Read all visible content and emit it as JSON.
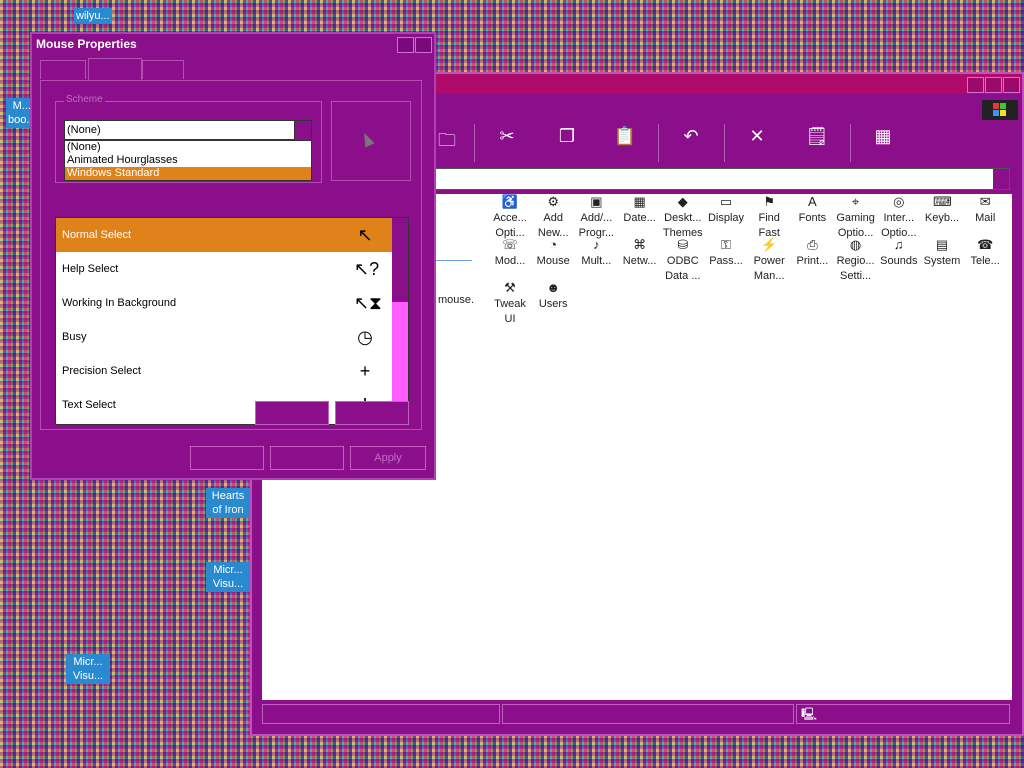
{
  "desktop": {
    "icons": [
      {
        "label": "wilyu..."
      },
      {
        "label": "M... boo..."
      },
      {
        "label": "Hearts of Iron"
      },
      {
        "label": "Micr... Visu..."
      },
      {
        "label": "Micr... Visu..."
      }
    ]
  },
  "control_panel": {
    "description_fragment": "mouse.",
    "items": [
      {
        "label": "Acce... Opti...",
        "icon": "accessibility-icon"
      },
      {
        "label": "Add New...",
        "icon": "add-hardware-icon"
      },
      {
        "label": "Add/... Progr...",
        "icon": "add-remove-programs-icon"
      },
      {
        "label": "Date...",
        "icon": "date-time-icon"
      },
      {
        "label": "Deskt... Themes",
        "icon": "desktop-themes-icon"
      },
      {
        "label": "Display",
        "icon": "display-icon"
      },
      {
        "label": "Find Fast",
        "icon": "find-fast-icon"
      },
      {
        "label": "Fonts",
        "icon": "fonts-icon"
      },
      {
        "label": "Gaming Optio...",
        "icon": "gaming-options-icon"
      },
      {
        "label": "Inter... Optio...",
        "icon": "internet-options-icon"
      },
      {
        "label": "Keyb...",
        "icon": "keyboard-icon"
      },
      {
        "label": "Mail",
        "icon": "mail-icon"
      },
      {
        "label": "Mod...",
        "icon": "modems-icon"
      },
      {
        "label": "Mouse",
        "icon": "mouse-icon"
      },
      {
        "label": "Mult...",
        "icon": "multimedia-icon"
      },
      {
        "label": "Netw...",
        "icon": "network-icon"
      },
      {
        "label": "ODBC Data ...",
        "icon": "odbc-icon"
      },
      {
        "label": "Pass...",
        "icon": "passwords-icon"
      },
      {
        "label": "Power Man...",
        "icon": "power-management-icon"
      },
      {
        "label": "Print...",
        "icon": "printers-icon"
      },
      {
        "label": "Regio... Setti...",
        "icon": "regional-settings-icon"
      },
      {
        "label": "Sounds",
        "icon": "sounds-icon"
      },
      {
        "label": "System",
        "icon": "system-icon"
      },
      {
        "label": "Tele...",
        "icon": "telephony-icon"
      },
      {
        "label": "Tweak UI",
        "icon": "tweak-ui-icon"
      },
      {
        "label": "Users",
        "icon": "users-icon"
      }
    ]
  },
  "mouse_dialog": {
    "title": "Mouse Properties",
    "scheme": {
      "group_label": "Scheme",
      "value": "(None)",
      "options": [
        "(None)",
        "Animated Hourglasses",
        "Windows Standard"
      ],
      "highlighted": "Windows Standard"
    },
    "cursors": [
      {
        "label": "Normal Select",
        "glyph": "↖",
        "icon": "normal-select-cursor-icon",
        "selected": true
      },
      {
        "label": "Help Select",
        "glyph": "↖?",
        "icon": "help-select-cursor-icon"
      },
      {
        "label": "Working In Background",
        "glyph": "↖⧗",
        "icon": "working-background-cursor-icon"
      },
      {
        "label": "Busy",
        "glyph": "◷",
        "icon": "busy-cursor-icon"
      },
      {
        "label": "Precision Select",
        "glyph": "+",
        "icon": "precision-select-cursor-icon"
      },
      {
        "label": "Text Select",
        "glyph": "I",
        "icon": "text-select-cursor-icon"
      }
    ],
    "buttons": {
      "apply": "Apply"
    }
  },
  "colors": {
    "window_bg": "#8b0e8b",
    "selection": "#e0821a",
    "scrollbar_track": "#ff5dff"
  }
}
